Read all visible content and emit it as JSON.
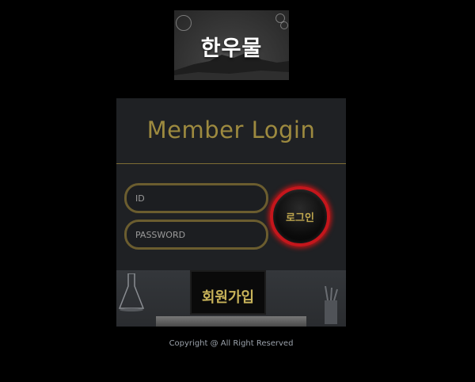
{
  "logo": {
    "text": "한우물"
  },
  "login": {
    "title": "Member Login",
    "id_placeholder": "ID",
    "password_placeholder": "PASSWORD",
    "login_button_label": "로그인",
    "join_button_label": "회원가입"
  },
  "footer": {
    "copyright": "Copyright @ All Right Reserved"
  },
  "colors": {
    "background": "#000000",
    "panel": "#1f2124",
    "gold_accent": "#9d8a3f",
    "login_ring": "#c4161c"
  }
}
